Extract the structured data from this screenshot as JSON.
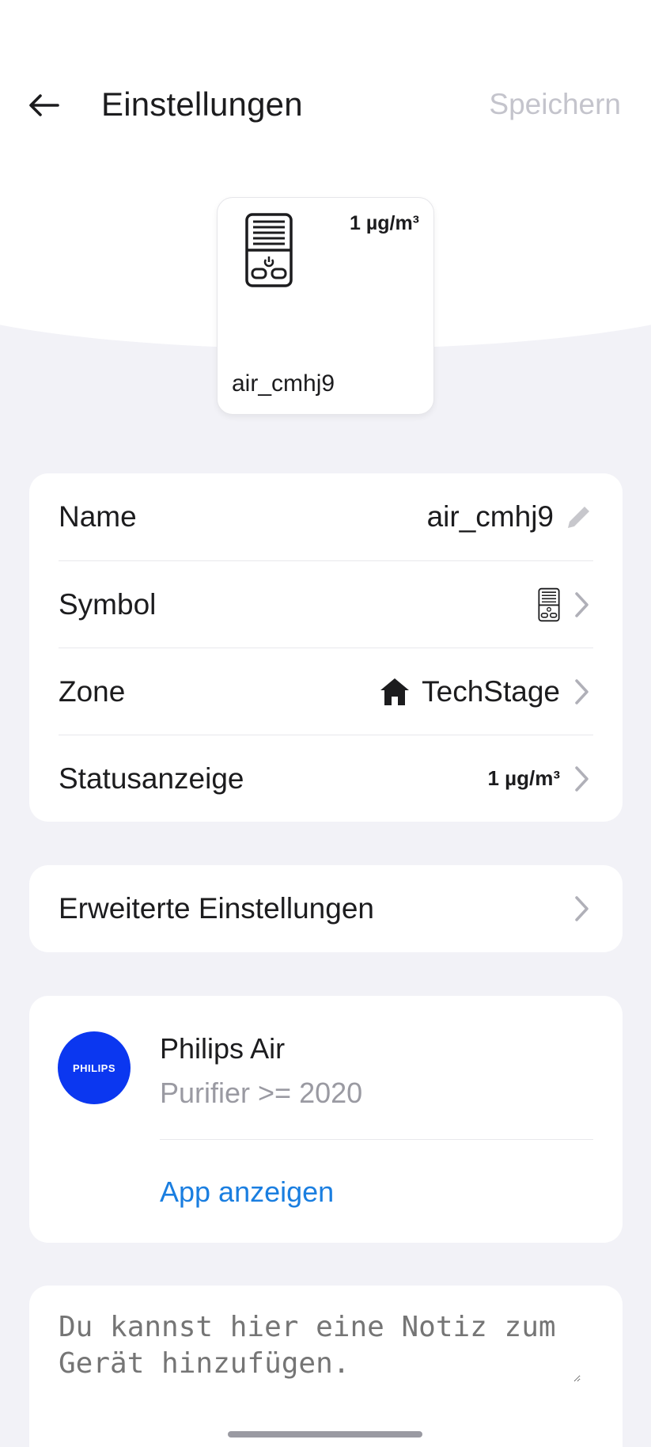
{
  "header": {
    "title": "Einstellungen",
    "save_label": "Speichern"
  },
  "device_tile": {
    "value": "1 µg/m³",
    "name": "air_cmhj9",
    "icon": "air-purifier-icon"
  },
  "settings": {
    "rows": [
      {
        "label": "Name",
        "value": "air_cmhj9",
        "icon": "pencil-icon"
      },
      {
        "label": "Symbol",
        "icon": "air-purifier-icon"
      },
      {
        "label": "Zone",
        "value": "TechStage",
        "icon": "home-icon"
      },
      {
        "label": "Statusanzeige",
        "value": "1 µg/m³"
      }
    ]
  },
  "advanced": {
    "label": "Erweiterte Einstellungen"
  },
  "app": {
    "logo_text": "PHILIPS",
    "title": "Philips Air",
    "subtitle": "Purifier >= 2020",
    "link_label": "App anzeigen",
    "logo_color": "#0b37f0",
    "link_color": "#1a7ee0"
  },
  "note": {
    "placeholder": "Du kannst hier eine Notiz zum Gerät hinzufügen."
  }
}
